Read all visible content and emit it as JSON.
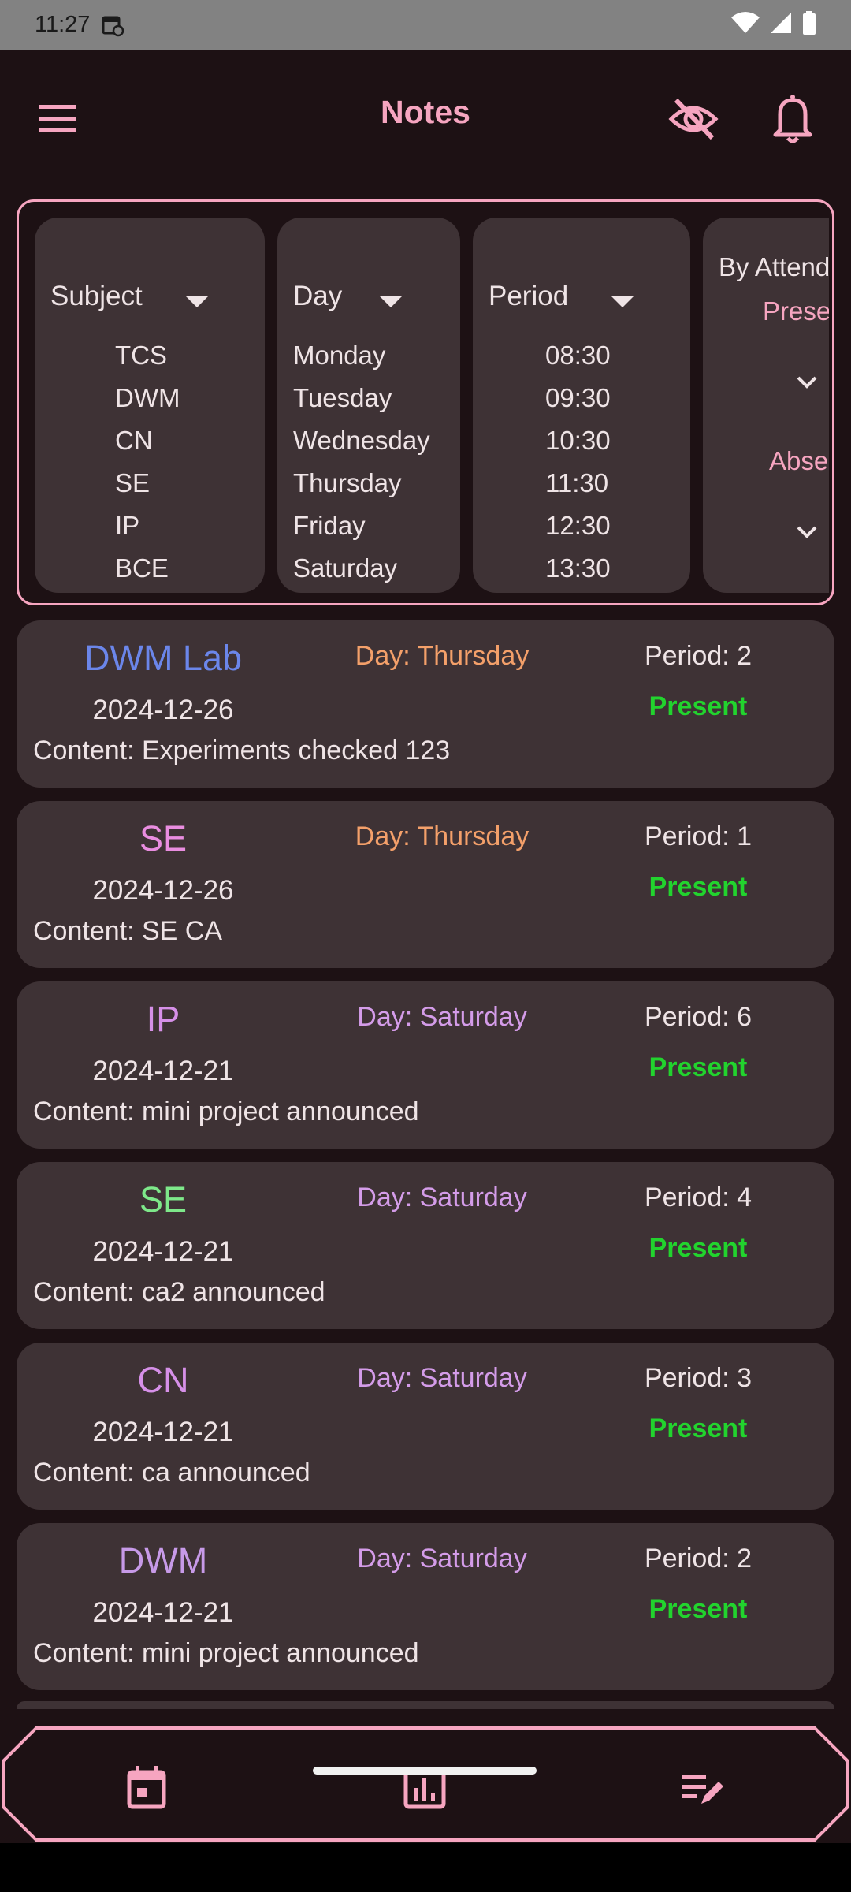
{
  "status_bar": {
    "time": "11:27"
  },
  "app_bar": {
    "title": "Notes"
  },
  "filters": {
    "subject": {
      "label": "Subject",
      "options": [
        "TCS",
        "DWM",
        "CN",
        "SE",
        "IP",
        "BCE"
      ]
    },
    "day": {
      "label": "Day",
      "options": [
        "Monday",
        "Tuesday",
        "Wednesday",
        "Thursday",
        "Friday",
        "Saturday"
      ]
    },
    "period": {
      "label": "Period",
      "options": [
        "08:30",
        "09:30",
        "10:30",
        "11:30",
        "12:30",
        "13:30"
      ]
    },
    "attendance": {
      "label": "By Attendance",
      "present_label": "Present",
      "absent_label": "Absent"
    }
  },
  "notes": [
    {
      "subject": "DWM Lab",
      "subject_color": "#6b86ea",
      "date": "2024-12-26",
      "day": "Day: Thursday",
      "day_color": "#f4a06a",
      "period": "Period: 2",
      "status": "Present",
      "content": "Content: Experiments checked 123"
    },
    {
      "subject": "SE",
      "subject_color": "#e98de0",
      "date": "2024-12-26",
      "day": "Day: Thursday",
      "day_color": "#f4a06a",
      "period": "Period: 1",
      "status": "Present",
      "content": "Content: SE CA"
    },
    {
      "subject": "IP",
      "subject_color": "#d690e8",
      "date": "2024-12-21",
      "day": "Day: Saturday",
      "day_color": "#d49ce9",
      "period": "Period: 6",
      "status": "Present",
      "content": "Content: mini project announced"
    },
    {
      "subject": "SE",
      "subject_color": "#7ee88a",
      "date": "2024-12-21",
      "day": "Day: Saturday",
      "day_color": "#d49ce9",
      "period": "Period: 4",
      "status": "Present",
      "content": "Content: ca2 announced"
    },
    {
      "subject": "CN",
      "subject_color": "#d690e8",
      "date": "2024-12-21",
      "day": "Day: Saturday",
      "day_color": "#d49ce9",
      "period": "Period: 3",
      "status": "Present",
      "content": "Content: ca announced"
    },
    {
      "subject": "DWM",
      "subject_color": "#c79ae8",
      "date": "2024-12-21",
      "day": "Day: Saturday",
      "day_color": "#d49ce9",
      "period": "Period: 2",
      "status": "Present",
      "content": "Content: mini project announced"
    }
  ],
  "bottom_nav": {
    "items": [
      "calendar-icon",
      "chart-icon",
      "notes-edit-icon"
    ]
  },
  "colors": {
    "accent": "#f6a5c0",
    "card_bg": "#3e3235",
    "background": "#1d1114",
    "present": "#22d32e"
  }
}
